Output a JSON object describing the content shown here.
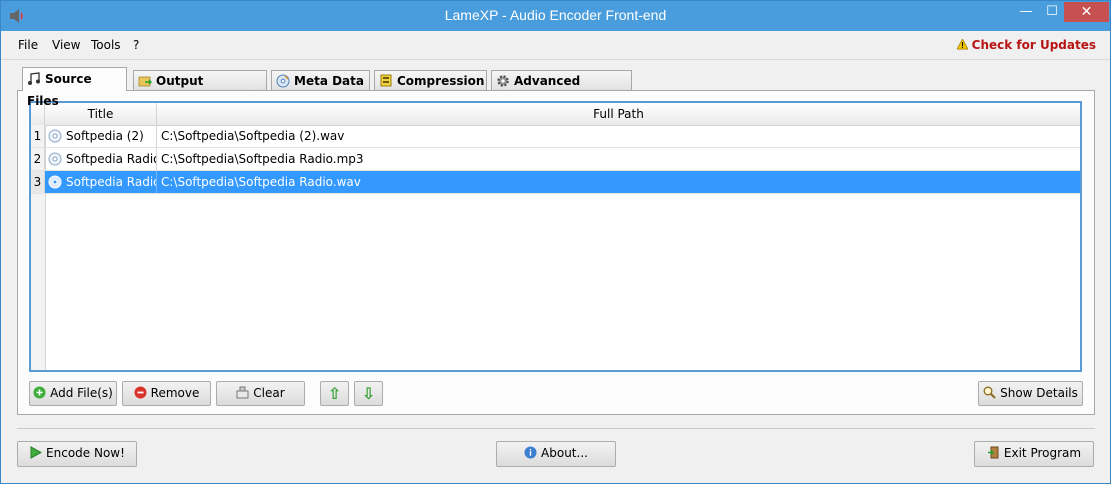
{
  "window": {
    "title": "LameXP - Audio Encoder Front-end",
    "minimize": "—",
    "maximize": "☐",
    "close": "✕"
  },
  "menu": {
    "items": [
      "File",
      "View",
      "Tools",
      "?"
    ],
    "updates": "Check for Updates"
  },
  "tabs": [
    {
      "label": "Source Files",
      "icon": "music-note-icon",
      "active": true
    },
    {
      "label": "Output Directory",
      "icon": "folder-arrow-icon",
      "active": false
    },
    {
      "label": "Meta Data",
      "icon": "cd-icon",
      "active": false
    },
    {
      "label": "Compression",
      "icon": "compress-icon",
      "active": false
    },
    {
      "label": "Advanced Options",
      "icon": "gear-icon",
      "active": false
    }
  ],
  "table": {
    "columns": [
      "Title",
      "Full Path"
    ],
    "rows": [
      {
        "num": "1",
        "title": "Softpedia (2)",
        "path": "C:\\Softpedia\\Softpedia (2).wav",
        "selected": false
      },
      {
        "num": "2",
        "title": "Softpedia Radio",
        "path": "C:\\Softpedia\\Softpedia Radio.mp3",
        "selected": false
      },
      {
        "num": "3",
        "title": "Softpedia Radio",
        "path": "C:\\Softpedia\\Softpedia Radio.wav",
        "selected": true
      }
    ]
  },
  "buttons": {
    "add": "Add File(s)",
    "remove": "Remove",
    "clear": "Clear",
    "up": "⇧",
    "down": "⇩",
    "details": "Show Details",
    "encode": "Encode Now!",
    "about": "About...",
    "exit": "Exit Program"
  },
  "colors": {
    "titlebar": "#4a9ddc",
    "selection": "#3399ff",
    "updates": "#b81414",
    "close_button": "#c75050"
  }
}
